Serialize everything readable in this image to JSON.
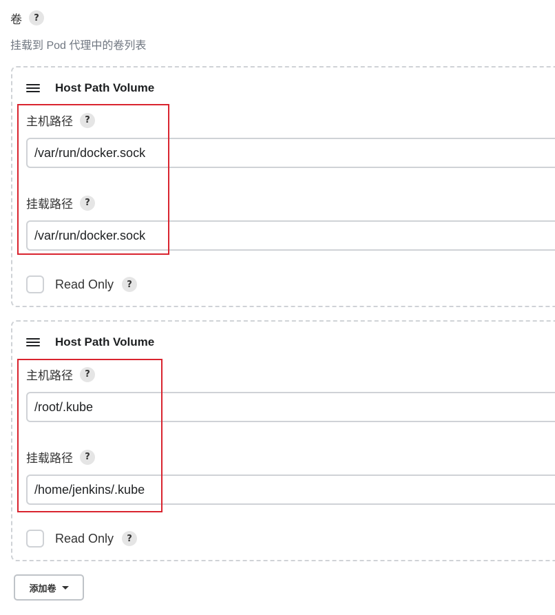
{
  "section": {
    "title": "卷",
    "help": "?",
    "description": "挂载到 Pod 代理中的卷列表"
  },
  "volumes": [
    {
      "type_label": "Host Path Volume",
      "host_path_label": "主机路径",
      "host_path_value": "/var/run/docker.sock",
      "mount_path_label": "挂载路径",
      "mount_path_value": "/var/run/docker.sock",
      "read_only_label": "Read Only",
      "read_only": false
    },
    {
      "type_label": "Host Path Volume",
      "host_path_label": "主机路径",
      "host_path_value": "/root/.kube",
      "mount_path_label": "挂载路径",
      "mount_path_value": "/home/jenkins/.kube",
      "read_only_label": "Read Only",
      "read_only": false
    }
  ],
  "add_button": {
    "label": "添加卷"
  },
  "colors": {
    "highlight": "#d9232e",
    "border": "#cfd2d6",
    "help_bg": "#e5e5e5"
  },
  "icons": [
    "help-icon",
    "drag-handle-icon",
    "checkbox",
    "caret-down-icon"
  ]
}
